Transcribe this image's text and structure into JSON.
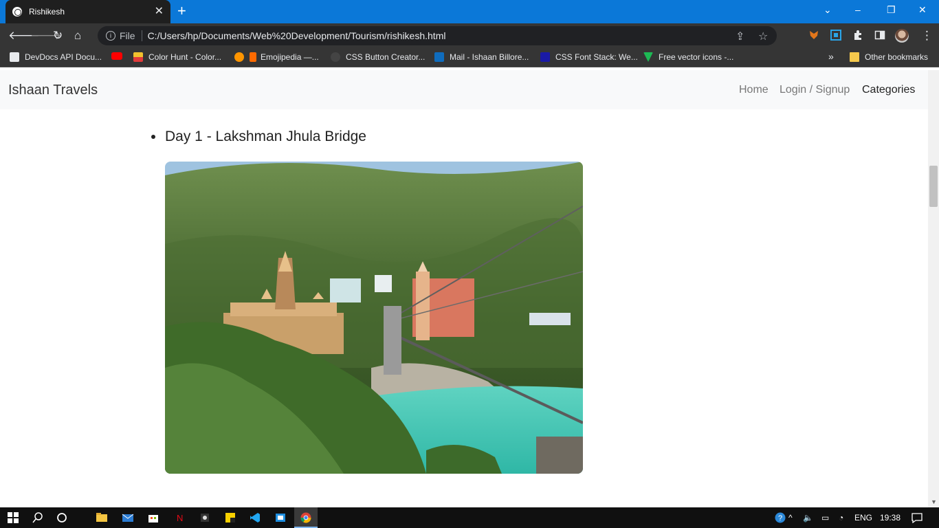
{
  "browser": {
    "tab_title": "Rishikesh",
    "new_tab": "+",
    "address": {
      "scheme_label": "File",
      "url": "C:/Users/hp/Documents/Web%20Development/Tourism/rishikesh.html"
    },
    "window_controls": {
      "dropdown": "⌄",
      "minimize": "–",
      "restore": "❐",
      "close": "✕"
    }
  },
  "bookmarks": [
    {
      "label": "DevDocs API Docu...",
      "color": "#5f6368"
    },
    {
      "label": "Color Hunt - Color...",
      "color": "#f2c12e"
    },
    {
      "label": "Emojipedia —...",
      "color": "#ff6a00"
    },
    {
      "label": "CSS Button Creator...",
      "color": "#444444"
    },
    {
      "label": "Mail - Ishaan Billore...",
      "color": "#0f6cbd"
    },
    {
      "label": "CSS Font Stack: We...",
      "color": "#1a1aa6"
    },
    {
      "label": "Free vector icons -...",
      "color": "#1db954"
    }
  ],
  "bookmarks_overflow": "»",
  "other_bookmarks": "Other bookmarks",
  "site": {
    "brand": "Ishaan Travels",
    "nav": [
      {
        "label": "Home",
        "active": false
      },
      {
        "label": "Login / Signup",
        "active": false
      },
      {
        "label": "Categories",
        "active": true
      }
    ],
    "day_item": "Day 1 - Lakshman Jhula Bridge",
    "photo_subject": "lakshman-jhula-bridge-photo"
  },
  "taskbar": {
    "language": "ENG",
    "time": "19:38"
  },
  "colors": {
    "titlebar": "#0b78d8",
    "toolbar": "#353535",
    "navbar": "#f8f9fa"
  }
}
